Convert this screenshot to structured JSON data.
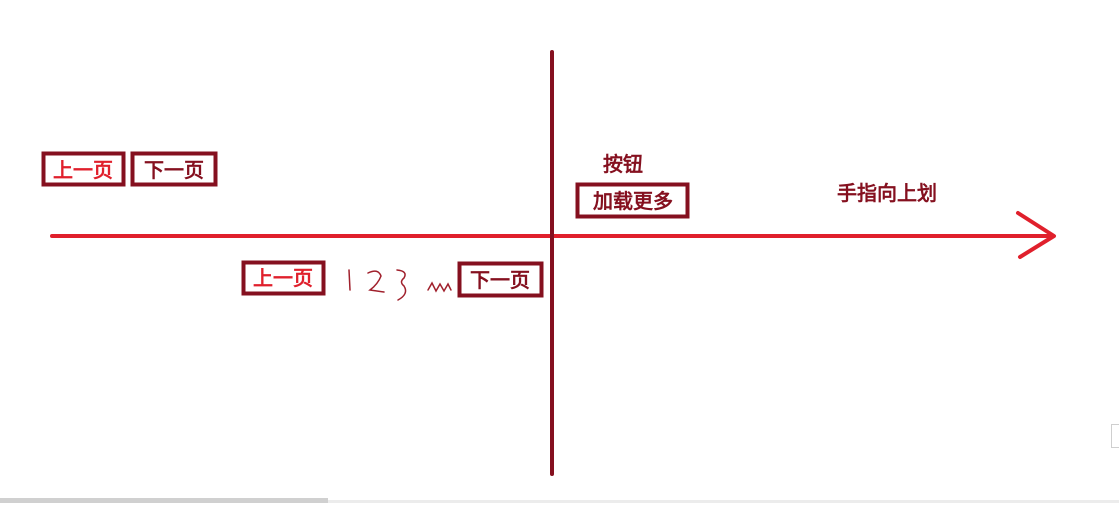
{
  "colors": {
    "axis_horizontal": "#e0202c",
    "axis_vertical": "#85101f",
    "box_border": "#85101f",
    "text_red": "#e0202c",
    "text_dark": "#85101f"
  },
  "left_top_group": {
    "prev_label": "上一页",
    "next_label": "下一页"
  },
  "left_bottom_group": {
    "prev_label": "上一页",
    "numbers_scribble": "1 2 3 ...",
    "next_label": "下一页"
  },
  "right_group": {
    "button_caption": "按钮",
    "load_more_label": "加载更多",
    "gesture_label": "手指向上划"
  }
}
